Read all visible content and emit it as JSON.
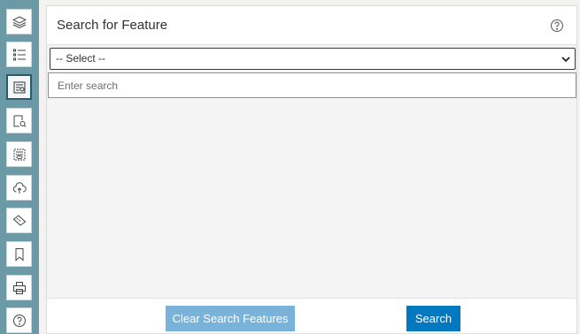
{
  "panel": {
    "title": "Search for Feature",
    "help_icon": "question-circle-icon"
  },
  "search": {
    "select_value": "-- Select --",
    "input_value": "",
    "input_placeholder": "Enter search"
  },
  "footer": {
    "clear_label": "Clear Search Features",
    "search_label": "Search"
  },
  "toolbar": {
    "tools": [
      {
        "icon": "layers-icon"
      },
      {
        "icon": "legend-list-icon"
      },
      {
        "icon": "search-feature-icon",
        "active": true
      },
      {
        "icon": "query-icon"
      },
      {
        "icon": "select-view-icon"
      },
      {
        "icon": "upload-icon"
      },
      {
        "icon": "measure-icon"
      },
      {
        "icon": "bookmark-icon"
      },
      {
        "icon": "print-icon"
      },
      {
        "icon": "help-icon"
      }
    ]
  },
  "colors": {
    "rail": "#6b9aa6",
    "primary_button": "#0079c1",
    "disabled_button": "#79b3d9"
  }
}
